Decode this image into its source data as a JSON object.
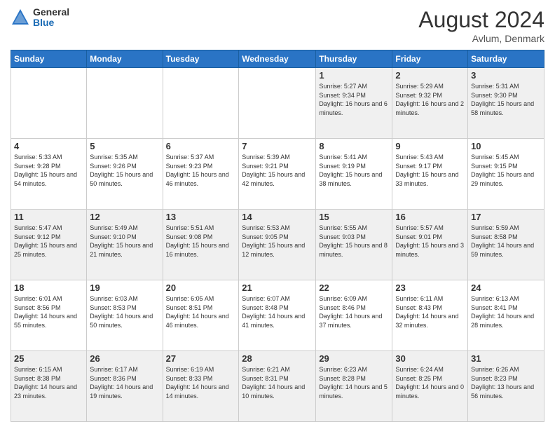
{
  "header": {
    "logo_general": "General",
    "logo_blue": "Blue",
    "month_year": "August 2024",
    "location": "Avlum, Denmark"
  },
  "weekdays": [
    "Sunday",
    "Monday",
    "Tuesday",
    "Wednesday",
    "Thursday",
    "Friday",
    "Saturday"
  ],
  "weeks": [
    [
      {
        "day": "",
        "info": ""
      },
      {
        "day": "",
        "info": ""
      },
      {
        "day": "",
        "info": ""
      },
      {
        "day": "",
        "info": ""
      },
      {
        "day": "1",
        "info": "Sunrise: 5:27 AM\nSunset: 9:34 PM\nDaylight: 16 hours\nand 6 minutes."
      },
      {
        "day": "2",
        "info": "Sunrise: 5:29 AM\nSunset: 9:32 PM\nDaylight: 16 hours\nand 2 minutes."
      },
      {
        "day": "3",
        "info": "Sunrise: 5:31 AM\nSunset: 9:30 PM\nDaylight: 15 hours\nand 58 minutes."
      }
    ],
    [
      {
        "day": "4",
        "info": "Sunrise: 5:33 AM\nSunset: 9:28 PM\nDaylight: 15 hours\nand 54 minutes."
      },
      {
        "day": "5",
        "info": "Sunrise: 5:35 AM\nSunset: 9:26 PM\nDaylight: 15 hours\nand 50 minutes."
      },
      {
        "day": "6",
        "info": "Sunrise: 5:37 AM\nSunset: 9:23 PM\nDaylight: 15 hours\nand 46 minutes."
      },
      {
        "day": "7",
        "info": "Sunrise: 5:39 AM\nSunset: 9:21 PM\nDaylight: 15 hours\nand 42 minutes."
      },
      {
        "day": "8",
        "info": "Sunrise: 5:41 AM\nSunset: 9:19 PM\nDaylight: 15 hours\nand 38 minutes."
      },
      {
        "day": "9",
        "info": "Sunrise: 5:43 AM\nSunset: 9:17 PM\nDaylight: 15 hours\nand 33 minutes."
      },
      {
        "day": "10",
        "info": "Sunrise: 5:45 AM\nSunset: 9:15 PM\nDaylight: 15 hours\nand 29 minutes."
      }
    ],
    [
      {
        "day": "11",
        "info": "Sunrise: 5:47 AM\nSunset: 9:12 PM\nDaylight: 15 hours\nand 25 minutes."
      },
      {
        "day": "12",
        "info": "Sunrise: 5:49 AM\nSunset: 9:10 PM\nDaylight: 15 hours\nand 21 minutes."
      },
      {
        "day": "13",
        "info": "Sunrise: 5:51 AM\nSunset: 9:08 PM\nDaylight: 15 hours\nand 16 minutes."
      },
      {
        "day": "14",
        "info": "Sunrise: 5:53 AM\nSunset: 9:05 PM\nDaylight: 15 hours\nand 12 minutes."
      },
      {
        "day": "15",
        "info": "Sunrise: 5:55 AM\nSunset: 9:03 PM\nDaylight: 15 hours\nand 8 minutes."
      },
      {
        "day": "16",
        "info": "Sunrise: 5:57 AM\nSunset: 9:01 PM\nDaylight: 15 hours\nand 3 minutes."
      },
      {
        "day": "17",
        "info": "Sunrise: 5:59 AM\nSunset: 8:58 PM\nDaylight: 14 hours\nand 59 minutes."
      }
    ],
    [
      {
        "day": "18",
        "info": "Sunrise: 6:01 AM\nSunset: 8:56 PM\nDaylight: 14 hours\nand 55 minutes."
      },
      {
        "day": "19",
        "info": "Sunrise: 6:03 AM\nSunset: 8:53 PM\nDaylight: 14 hours\nand 50 minutes."
      },
      {
        "day": "20",
        "info": "Sunrise: 6:05 AM\nSunset: 8:51 PM\nDaylight: 14 hours\nand 46 minutes."
      },
      {
        "day": "21",
        "info": "Sunrise: 6:07 AM\nSunset: 8:48 PM\nDaylight: 14 hours\nand 41 minutes."
      },
      {
        "day": "22",
        "info": "Sunrise: 6:09 AM\nSunset: 8:46 PM\nDaylight: 14 hours\nand 37 minutes."
      },
      {
        "day": "23",
        "info": "Sunrise: 6:11 AM\nSunset: 8:43 PM\nDaylight: 14 hours\nand 32 minutes."
      },
      {
        "day": "24",
        "info": "Sunrise: 6:13 AM\nSunset: 8:41 PM\nDaylight: 14 hours\nand 28 minutes."
      }
    ],
    [
      {
        "day": "25",
        "info": "Sunrise: 6:15 AM\nSunset: 8:38 PM\nDaylight: 14 hours\nand 23 minutes."
      },
      {
        "day": "26",
        "info": "Sunrise: 6:17 AM\nSunset: 8:36 PM\nDaylight: 14 hours\nand 19 minutes."
      },
      {
        "day": "27",
        "info": "Sunrise: 6:19 AM\nSunset: 8:33 PM\nDaylight: 14 hours\nand 14 minutes."
      },
      {
        "day": "28",
        "info": "Sunrise: 6:21 AM\nSunset: 8:31 PM\nDaylight: 14 hours\nand 10 minutes."
      },
      {
        "day": "29",
        "info": "Sunrise: 6:23 AM\nSunset: 8:28 PM\nDaylight: 14 hours\nand 5 minutes."
      },
      {
        "day": "30",
        "info": "Sunrise: 6:24 AM\nSunset: 8:25 PM\nDaylight: 14 hours\nand 0 minutes."
      },
      {
        "day": "31",
        "info": "Sunrise: 6:26 AM\nSunset: 8:23 PM\nDaylight: 13 hours\nand 56 minutes."
      }
    ]
  ]
}
